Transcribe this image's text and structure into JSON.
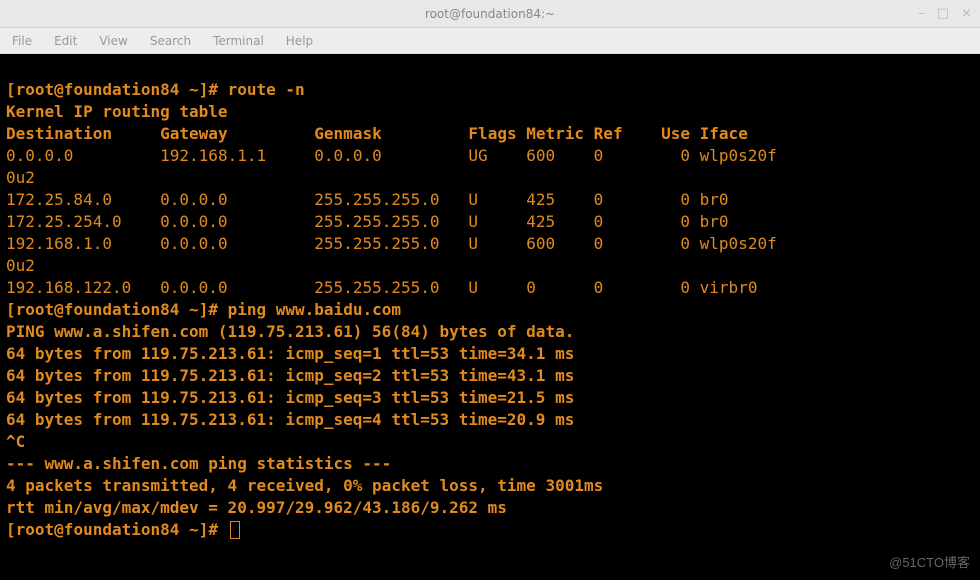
{
  "window": {
    "title": "root@foundation84:~"
  },
  "menubar": {
    "file": "File",
    "edit": "Edit",
    "view": "View",
    "search": "Search",
    "terminal": "Terminal",
    "help": "Help"
  },
  "prompt": {
    "user_host": "root@foundation84",
    "cwd": "~",
    "open": "[",
    "close": "]#"
  },
  "cmd1": "route -n",
  "route": {
    "header": "Kernel IP routing table",
    "cols": {
      "destination": "Destination",
      "gateway": "Gateway",
      "genmask": "Genmask",
      "flags": "Flags",
      "metric": "Metric",
      "ref": "Ref",
      "use": "Use",
      "iface": "Iface"
    },
    "rows": [
      {
        "dest": "0.0.0.0",
        "gw": "192.168.1.1",
        "mask": "0.0.0.0",
        "flags": "UG",
        "metric": "600",
        "ref": "0",
        "use": "0",
        "iface": "wlp0s20f",
        "wrap": "0u2"
      },
      {
        "dest": "172.25.84.0",
        "gw": "0.0.0.0",
        "mask": "255.255.255.0",
        "flags": "U",
        "metric": "425",
        "ref": "0",
        "use": "0",
        "iface": "br0"
      },
      {
        "dest": "172.25.254.0",
        "gw": "0.0.0.0",
        "mask": "255.255.255.0",
        "flags": "U",
        "metric": "425",
        "ref": "0",
        "use": "0",
        "iface": "br0"
      },
      {
        "dest": "192.168.1.0",
        "gw": "0.0.0.0",
        "mask": "255.255.255.0",
        "flags": "U",
        "metric": "600",
        "ref": "0",
        "use": "0",
        "iface": "wlp0s20f",
        "wrap": "0u2"
      },
      {
        "dest": "192.168.122.0",
        "gw": "0.0.0.0",
        "mask": "255.255.255.0",
        "flags": "U",
        "metric": "0",
        "ref": "0",
        "use": "0",
        "iface": "virbr0"
      }
    ]
  },
  "cmd2": "ping www.baidu.com",
  "ping": {
    "first": "PING www.a.shifen.com (119.75.213.61) 56(84) bytes of data.",
    "lines": [
      "64 bytes from 119.75.213.61: icmp_seq=1 ttl=53 time=34.1 ms",
      "64 bytes from 119.75.213.61: icmp_seq=2 ttl=53 time=43.1 ms",
      "64 bytes from 119.75.213.61: icmp_seq=3 ttl=53 time=21.5 ms",
      "64 bytes from 119.75.213.61: icmp_seq=4 ttl=53 time=20.9 ms"
    ],
    "interrupt": "^C",
    "stats_header": "--- www.a.shifen.com ping statistics ---",
    "stats1": "4 packets transmitted, 4 received, 0% packet loss, time 3001ms",
    "stats2": "rtt min/avg/max/mdev = 20.997/29.962/43.186/9.262 ms"
  },
  "watermark": "@51CTO博客"
}
